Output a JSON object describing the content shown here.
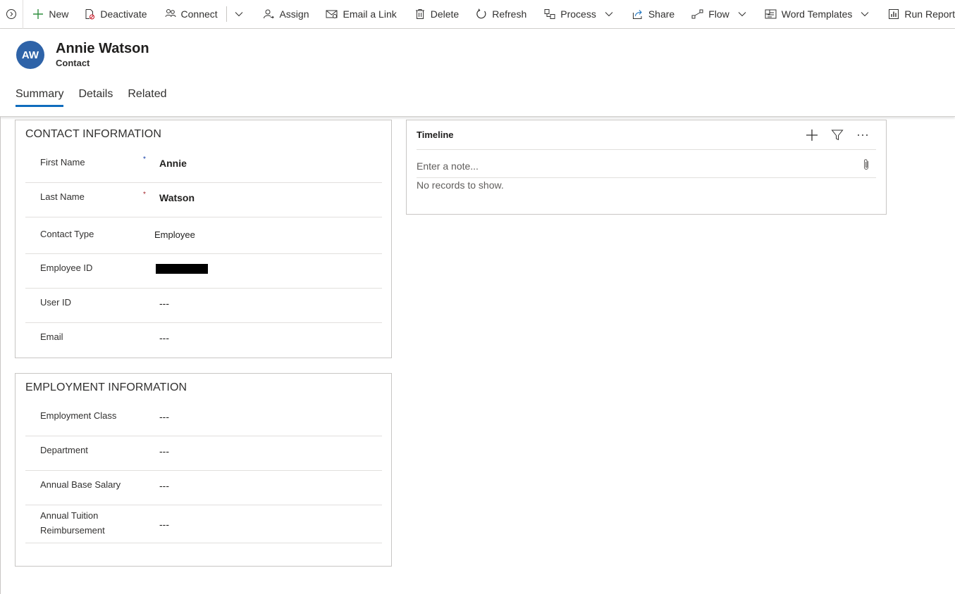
{
  "command_bar": {
    "new": "New",
    "deactivate": "Deactivate",
    "connect": "Connect",
    "assign": "Assign",
    "email_link": "Email a Link",
    "delete": "Delete",
    "refresh": "Refresh",
    "process": "Process",
    "share": "Share",
    "flow": "Flow",
    "word_templates": "Word Templates",
    "run_report": "Run Report"
  },
  "record": {
    "initials": "AW",
    "name": "Annie Watson",
    "entity": "Contact",
    "avatar_color": "#2e63a8"
  },
  "tabs": [
    {
      "label": "Summary",
      "active": true
    },
    {
      "label": "Details",
      "active": false
    },
    {
      "label": "Related",
      "active": false
    }
  ],
  "contact_info": {
    "title": "CONTACT INFORMATION",
    "fields": [
      {
        "label": "First Name",
        "required": "*",
        "value": "Annie"
      },
      {
        "label": "Last Name",
        "required": "*",
        "value": "Watson"
      },
      {
        "label": "Contact Type",
        "value": "Employee"
      },
      {
        "label": "Employee ID",
        "value": ""
      },
      {
        "label": "User ID",
        "value": "---"
      },
      {
        "label": "Email",
        "value": "---"
      }
    ]
  },
  "employment_info": {
    "title": "EMPLOYMENT INFORMATION",
    "fields": [
      {
        "label": "Employment Class",
        "value": "---"
      },
      {
        "label": "Department",
        "value": "---"
      },
      {
        "label": "Annual Base Salary",
        "value": "---"
      },
      {
        "label": "Annual Tuition Reimbursement",
        "value": "---"
      }
    ]
  },
  "timeline": {
    "title": "Timeline",
    "note_placeholder": "Enter a note...",
    "empty_text": "No records to show."
  },
  "colors": {
    "accent": "#0f6cbd",
    "required": "#a4262c"
  }
}
